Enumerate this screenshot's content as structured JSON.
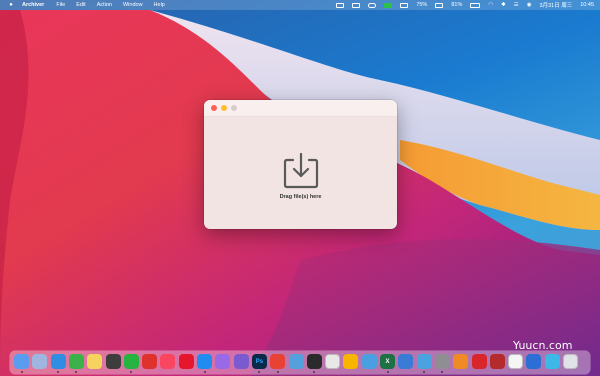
{
  "menubar": {
    "app_name": "Archiver",
    "menus": [
      "File",
      "Edit",
      "Action",
      "Window",
      "Help"
    ],
    "battery_percent": "75%",
    "battery_percent_2": "81%",
    "date": "3月31日 周三",
    "time": "10:45"
  },
  "window": {
    "drop_label": "Drag file(s) here"
  },
  "dock": {
    "icons": [
      {
        "name": "finder-icon",
        "color": "#5a9cf0",
        "glyph": ""
      },
      {
        "name": "launchpad-icon",
        "color": "#9fb7e0",
        "glyph": ""
      },
      {
        "name": "safari-icon",
        "color": "#2f8de4",
        "glyph": ""
      },
      {
        "name": "facetime-icon",
        "color": "#3bb14a",
        "glyph": ""
      },
      {
        "name": "notes-icon",
        "color": "#f6d35c",
        "glyph": ""
      },
      {
        "name": "qq-icon",
        "color": "#3d3d3d",
        "glyph": ""
      },
      {
        "name": "wechat-icon",
        "color": "#26b340",
        "glyph": ""
      },
      {
        "name": "pinduoduo-icon",
        "color": "#e0322c",
        "glyph": ""
      },
      {
        "name": "music-icon",
        "color": "#fa4560",
        "glyph": ""
      },
      {
        "name": "weibo-icon",
        "color": "#e6162d",
        "glyph": ""
      },
      {
        "name": "app-store-icon",
        "color": "#1f8cf0",
        "glyph": ""
      },
      {
        "name": "pixelmator-icon",
        "color": "#9a6ae6",
        "glyph": ""
      },
      {
        "name": "affinity-icon",
        "color": "#7b5ad1",
        "glyph": ""
      },
      {
        "name": "photoshop-icon",
        "color": "#0b2a4a",
        "glyph": "Ps"
      },
      {
        "name": "chrome-icon",
        "color": "#e94235",
        "glyph": ""
      },
      {
        "name": "sequel-icon",
        "color": "#55a0dc",
        "glyph": ""
      },
      {
        "name": "terminal-icon",
        "color": "#2a2a2a",
        "glyph": ""
      },
      {
        "name": "pencil-app-icon",
        "color": "#e8e8e8",
        "glyph": ""
      },
      {
        "name": "sketch-icon",
        "color": "#f7b500",
        "glyph": ""
      },
      {
        "name": "cloud-icon",
        "color": "#4a9fe0",
        "glyph": ""
      },
      {
        "name": "excel-icon",
        "color": "#1e7145",
        "glyph": "X"
      },
      {
        "name": "edit-app-icon",
        "color": "#3a7bd5",
        "glyph": ""
      },
      {
        "name": "network-icon",
        "color": "#4aa3df",
        "glyph": ""
      },
      {
        "name": "settings-icon",
        "color": "#8e8e93",
        "glyph": ""
      },
      {
        "name": "pinwheel-icon",
        "color": "#f08a24",
        "glyph": ""
      },
      {
        "name": "news-icon",
        "color": "#d8262b",
        "glyph": ""
      },
      {
        "name": "video-icon",
        "color": "#b52a2a",
        "glyph": ""
      },
      {
        "name": "preview-icon",
        "color": "#f5f5f5",
        "glyph": ""
      },
      {
        "name": "mail-icon",
        "color": "#2b6fd6",
        "glyph": ""
      },
      {
        "name": "screen-icon",
        "color": "#3db6e8",
        "glyph": ""
      },
      {
        "name": "trash-icon",
        "color": "#dfe3e8",
        "glyph": ""
      }
    ]
  },
  "watermark": "Yuucn.com"
}
